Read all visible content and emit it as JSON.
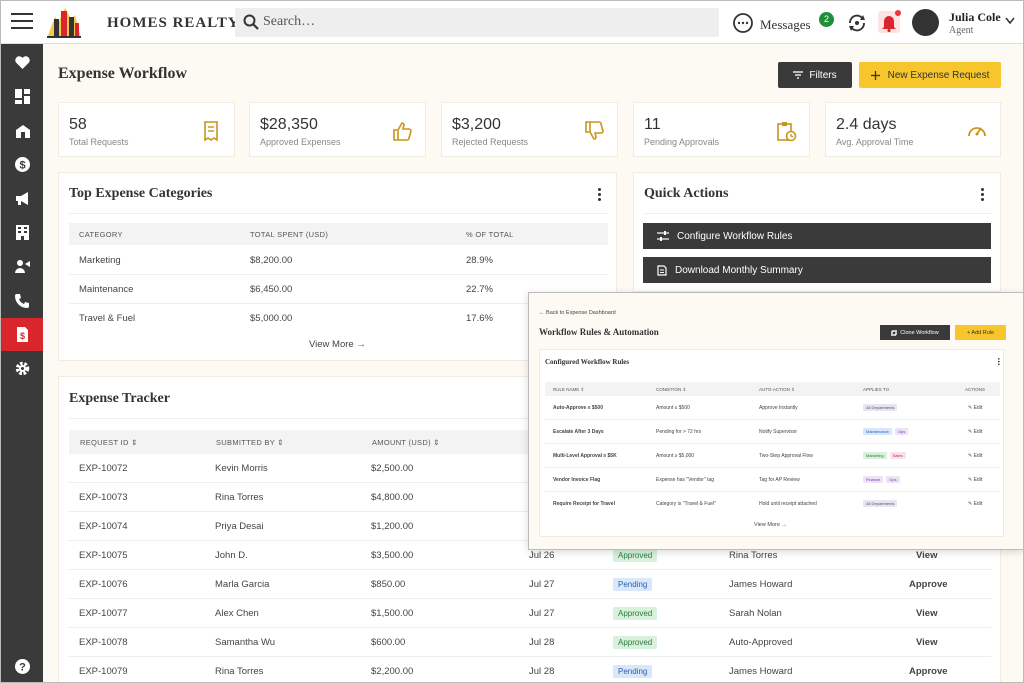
{
  "header": {
    "brand": "HOMES REALTY",
    "search_placeholder": "Search…",
    "messages_label": "Messages",
    "messages_count": "2",
    "user_name": "Julia Cole",
    "user_role": "Agent"
  },
  "sidebar": {
    "items": [
      "heart-icon",
      "dashboard-icon",
      "property-icon",
      "dollar-icon",
      "megaphone-icon",
      "building-icon",
      "agent-icon",
      "phone-icon",
      "expense-icon",
      "gear-icon",
      "help-icon"
    ],
    "active": "expense-icon"
  },
  "page": {
    "title": "Expense Workflow",
    "filters_label": "Filters",
    "new_request_label": "New Expense Request"
  },
  "stats": [
    {
      "value": "58",
      "label": "Total Requests"
    },
    {
      "value": "$28,350",
      "label": "Approved Expenses"
    },
    {
      "value": "$3,200",
      "label": "Rejected Requests"
    },
    {
      "value": "11",
      "label": "Pending Approvals"
    },
    {
      "value": "2.4 days",
      "label": "Avg. Approval Time"
    }
  ],
  "categories": {
    "title": "Top Expense Categories",
    "headers": [
      "CATEGORY",
      "TOTAL SPENT (USD)",
      "% OF TOTAL"
    ],
    "rows": [
      [
        "Marketing",
        "$8,200.00",
        "28.9%"
      ],
      [
        "Maintenance",
        "$6,450.00",
        "22.7%"
      ],
      [
        "Travel & Fuel",
        "$5,000.00",
        "17.6%"
      ]
    ],
    "view_more": "View More →"
  },
  "quick_actions": {
    "title": "Quick Actions",
    "buttons": [
      "Configure Workflow Rules",
      "Download Monthly Summary"
    ]
  },
  "tracker": {
    "title": "Expense Tracker",
    "headers": [
      "REQUEST ID",
      "SUBMITTED BY",
      "AMOUNT (USD)"
    ],
    "rows": [
      {
        "id": "EXP-10072",
        "by": "Kevin Morris",
        "amount": "$2,500.00",
        "date": "",
        "status": "",
        "approver": "",
        "action": ""
      },
      {
        "id": "EXP-10073",
        "by": "Rina Torres",
        "amount": "$4,800.00",
        "date": "",
        "status": "",
        "approver": "",
        "action": ""
      },
      {
        "id": "EXP-10074",
        "by": "Priya Desai",
        "amount": "$1,200.00",
        "date": "",
        "status": "",
        "approver": "",
        "action": ""
      },
      {
        "id": "EXP-10075",
        "by": "John D.",
        "amount": "$3,500.00",
        "date": "Jul 26",
        "status": "Approved",
        "approver": "Rina Torres",
        "action": "View"
      },
      {
        "id": "EXP-10076",
        "by": "Marla Garcia",
        "amount": "$850.00",
        "date": "Jul 27",
        "status": "Pending",
        "approver": "James Howard",
        "action": "Approve"
      },
      {
        "id": "EXP-10077",
        "by": "Alex Chen",
        "amount": "$1,500.00",
        "date": "Jul 27",
        "status": "Approved",
        "approver": "Sarah Nolan",
        "action": "View"
      },
      {
        "id": "EXP-10078",
        "by": "Samantha Wu",
        "amount": "$600.00",
        "date": "Jul 28",
        "status": "Approved",
        "approver": "Auto-Approved",
        "action": "View"
      },
      {
        "id": "EXP-10079",
        "by": "Rina Torres",
        "amount": "$2,200.00",
        "date": "Jul 28",
        "status": "Pending",
        "approver": "James Howard",
        "action": "Approve"
      }
    ]
  },
  "overlay": {
    "back": "← Back to Expense Dashboard",
    "title": "Workflow Rules & Automation",
    "clone_label": "Clone Workflow",
    "add_label": "+ Add Rule",
    "card_title": "Configured Workflow Rules",
    "headers": [
      "RULE NAME ⇕",
      "CONDITION ⇕",
      "AUTO-ACTION ⇕",
      "APPLIES TO",
      "ACTIONS"
    ],
    "rows": [
      {
        "name": "Auto-Approve ≤ $500",
        "condition": "Amount ≤ $500",
        "action": "Approve Instantly",
        "tags": [
          "All Departments"
        ],
        "edit": "Edit"
      },
      {
        "name": "Escalate After 3 Days",
        "condition": "Pending for > 72 hrs",
        "action": "Notify Supervisor",
        "tags": [
          "Maintenance",
          "Ops"
        ],
        "edit": "Edit"
      },
      {
        "name": "Multi-Level Approval ≥ $5K",
        "condition": "Amount ≥ $5,000",
        "action": "Two-Step Approval Flow",
        "tags": [
          "Marketing",
          "Sales"
        ],
        "edit": "Edit"
      },
      {
        "name": "Vendor Invoice Flag",
        "condition": "Expense has \"Vendor\" tag",
        "action": "Tag for AP Review",
        "tags": [
          "Finance",
          "Ops"
        ],
        "edit": "Edit"
      },
      {
        "name": "Require Receipt for Travel",
        "condition": "Category is \"Travel & Fuel\"",
        "action": "Hold until receipt attached",
        "tags": [
          "All Departments"
        ],
        "edit": "Edit"
      }
    ],
    "view_more": "View More →"
  },
  "colors": {
    "accent": "#f7c52c",
    "dark": "#3a3a3a",
    "active_nav": "#d9262c",
    "approved_bg": "#d8f1dc",
    "pending_bg": "#d9e7fb"
  }
}
